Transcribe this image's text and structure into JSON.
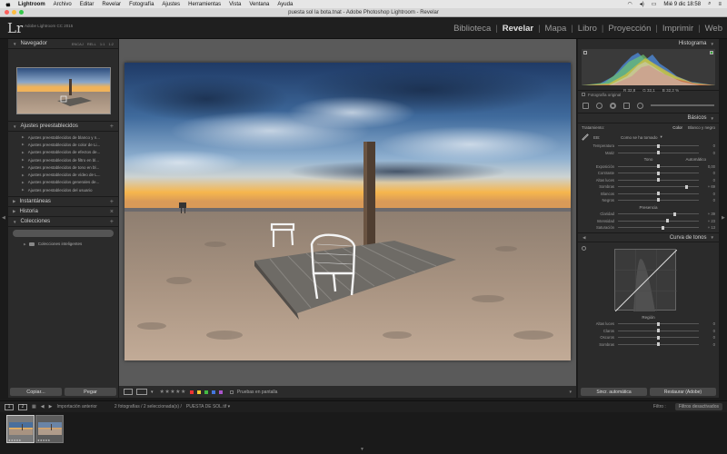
{
  "menubar": {
    "app": "Lightroom",
    "items": [
      "Archivo",
      "Editar",
      "Revelar",
      "Fotografía",
      "Ajustes",
      "Herramientas",
      "Vista",
      "Ventana",
      "Ayuda"
    ],
    "clock": "Mié 9 dic  18:58"
  },
  "window": {
    "title": "puesta sol la bota.tnat - Adobe Photoshop Lightroom - Revelar"
  },
  "identity": {
    "logo": "Lr",
    "subtitle": "Adobe Lightroom CC 2015"
  },
  "modules": [
    "Biblioteca",
    "Revelar",
    "Mapa",
    "Libro",
    "Proyección",
    "Imprimir",
    "Web"
  ],
  "active_module": "Revelar",
  "left": {
    "navigator": {
      "title": "Navegador",
      "options": [
        "ENCAJ",
        "RELL",
        "1:1",
        "1:2"
      ]
    },
    "presets": {
      "title": "Ajustes preestablecidos",
      "items": [
        "Ajustes preestablecidos de blanco y n...",
        "Ajustes preestablecidos de color de Li...",
        "Ajustes preestablecidos de efectos de...",
        "Ajustes preestablecidos de filtro en bl...",
        "Ajustes preestablecidos de tono en bl...",
        "Ajustes preestablecidos de vídeo de L...",
        "Ajustes preestablecidos generales de...",
        "Ajustes preestablecidos del usuario"
      ]
    },
    "snapshots": "Instantáneas",
    "history": "Historia",
    "collections": {
      "title": "Colecciones",
      "smart": "Colecciones inteligentes"
    },
    "buttons": {
      "copy": "Copiar...",
      "paste": "Pegar"
    }
  },
  "toolbar": {
    "stars": "★★★★★",
    "proof": "Pruebas en pantalla"
  },
  "right": {
    "histogram": {
      "title": "Histograma",
      "r": "32,8",
      "g": "32,1",
      "b": "32,2",
      "unit": "%",
      "original": "Fotografía original"
    },
    "basic": {
      "title": "Básicos",
      "treatment": "Tratamiento:",
      "color": "Color",
      "bw": "Blanco y negro",
      "wb_label": "EB:",
      "wb_value": "Como se ha tomado",
      "tone_label": "Tono",
      "auto": "Automático",
      "presence_label": "Presencia",
      "sliders_wb": [
        {
          "label": "Temperatura",
          "value": "0",
          "pos": 0.5
        },
        {
          "label": "Matiz",
          "value": "0",
          "pos": 0.5
        }
      ],
      "sliders_tone": [
        {
          "label": "Exposición",
          "value": "0,00",
          "pos": 0.5
        },
        {
          "label": "Contraste",
          "value": "0",
          "pos": 0.5
        },
        {
          "label": "Altas luces",
          "value": "0",
          "pos": 0.5
        },
        {
          "label": "Sombras",
          "value": "+ 69",
          "pos": 0.85
        },
        {
          "label": "Blancos",
          "value": "0",
          "pos": 0.5
        },
        {
          "label": "Negros",
          "value": "0",
          "pos": 0.5
        }
      ],
      "sliders_presence": [
        {
          "label": "Claridad",
          "value": "+ 39",
          "pos": 0.7
        },
        {
          "label": "Intensidad",
          "value": "+ 23",
          "pos": 0.61
        },
        {
          "label": "Saturación",
          "value": "+ 13",
          "pos": 0.56
        }
      ]
    },
    "tonecurve": {
      "title": "Curva de tonos",
      "region": "Región",
      "sliders": [
        {
          "label": "Altas luces",
          "value": "0",
          "pos": 0.5
        },
        {
          "label": "Claros",
          "value": "0",
          "pos": 0.5
        },
        {
          "label": "Oscuros",
          "value": "0",
          "pos": 0.5
        },
        {
          "label": "Sombras",
          "value": "0",
          "pos": 0.5
        }
      ]
    },
    "buttons": {
      "sync": "Sincr. automática",
      "reset": "Restaurar (Adobe)"
    }
  },
  "filmbar": {
    "prev": "Importación anterior",
    "count": "2 fotografías / 2 seleccionada(s) /",
    "file": "PUESTA DE SOL.tif ▾",
    "filter": "Filtro :",
    "filter_btn": "Filtros desactivados"
  },
  "filmstrip": {
    "stars": "★★★★★"
  },
  "colors": {
    "panel": "#2b2b2b",
    "center_bg": "#5a5a5a",
    "accent_active": "#e0e0e0"
  }
}
